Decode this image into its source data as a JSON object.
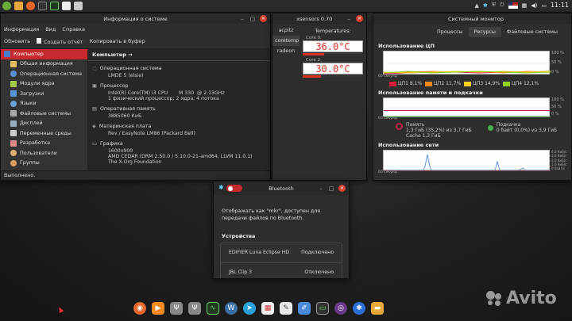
{
  "topbar": {
    "time": "11:11",
    "tray_flag": "us-flag",
    "icons": [
      "mint-menu-icon",
      "files-icon",
      "firefox-icon",
      "terminal-icon",
      "system-monitor-icon",
      "xsensors-icon",
      "bluetooth-icon"
    ]
  },
  "sysinfo": {
    "title": "Информация о системе",
    "menu": [
      "Информация",
      "Вид",
      "Справка"
    ],
    "toolbar": [
      "Обновить",
      "Создать отчёт",
      "Копировать в буфер"
    ],
    "sidebar": [
      "Компьютер",
      "Общая информация",
      "Операционная система",
      "Модули ядра",
      "Загрузки",
      "Языки",
      "Файловые системы",
      "Дисплей",
      "Переменные среды",
      "Разработка",
      "Пользователи",
      "Группы"
    ],
    "content_header": "Компьютер →",
    "sections": [
      {
        "title": "Операционная система",
        "lines": [
          "LMDE 5 (elsie)"
        ]
      },
      {
        "title": "Процессор",
        "lines": [
          "Intel(R) Core(TM) i3 CPU       M 330  @ 2.13GHz",
          "1 физический процессор; 2 ядра; 4 потока"
        ]
      },
      {
        "title": "Оперативная память",
        "lines": [
          "3885060 КиБ"
        ]
      },
      {
        "title": "Материнская плата",
        "lines": [
          "Rev / EasyNote LM86 (Packard Bell)"
        ]
      },
      {
        "title": "Графика",
        "lines": [
          "1600x900",
          "AMD CEDAR (DRM 2.50.0 / 5.10.0-21-amd64, LLVM 11.0.1)",
          "The X.Org Foundation"
        ]
      }
    ],
    "status": "Выполнено."
  },
  "xsensors": {
    "title": "xsensors 0.70",
    "tabs": [
      "acpitz",
      "coretemp",
      "radeon"
    ],
    "group_title": "Temperatures:",
    "sensors": [
      {
        "label": "Core 0:",
        "value": "36.0°C",
        "level": 0.36
      },
      {
        "label": "Core 2:",
        "value": "30.0°C",
        "level": 0.3
      }
    ]
  },
  "sysmon": {
    "title": "Системный монитор",
    "tabs": [
      "Процессы",
      "Ресурсы",
      "Файловые системы"
    ],
    "cpu": {
      "heading": "Использование ЦП",
      "axis": "60 секунд",
      "ticks": [
        "100 %",
        "50 %",
        "0 %"
      ],
      "legend": [
        {
          "name": "ЦП1",
          "value": "8,1%",
          "color": "#d81b3c"
        },
        {
          "name": "ЦП2",
          "value": "11,7%",
          "color": "#f08a1c"
        },
        {
          "name": "ЦП3",
          "value": "14,9%",
          "color": "#f2d21a"
        },
        {
          "name": "ЦП4",
          "value": "12,1%",
          "color": "#8fd11e"
        }
      ]
    },
    "mem": {
      "heading": "Использование памяти и подкачки",
      "axis": "60 секунд",
      "ticks": [
        "100 %",
        "50 %",
        "0 %"
      ],
      "mem_label": "Память",
      "mem_value": "1,3 ГиБ (35,2%) из 3,7 ГиБ",
      "cache": "Cache 1,3 ГиБ",
      "swap_label": "Подкачка",
      "swap_value": "0 байт (0,0%) из 3,9 ГиБ"
    },
    "net": {
      "heading": "Использование сети",
      "axis": "60 секунд",
      "ticks": [
        "4,0 КиБ/с",
        "3,0 КиБ/с",
        "2,0 КиБ/с",
        "1,0 КиБ/с",
        "0 байт/с"
      ]
    }
  },
  "bluetooth": {
    "title": "Bluetooth",
    "message": "Отображать как \"mkr\", доступен для передачи файлов по Bluetooth.",
    "devices_heading": "Устройства",
    "devices": [
      {
        "name": "EDIFIER Luna Eclipse HD",
        "status": "Подключено"
      },
      {
        "name": "JBL Clip 3",
        "status": "Отключено"
      }
    ]
  },
  "watermark": "Avito",
  "dock_icons": [
    "firefox-icon",
    "media-player-icon",
    "usb-icon",
    "usb-icon",
    "system-monitor-icon",
    "wordpress-icon",
    "telegram-icon",
    "hardinfo-icon",
    "gedit-icon",
    "terminal-icon",
    "camera-icon",
    "bluetooth-icon",
    "files-icon"
  ]
}
